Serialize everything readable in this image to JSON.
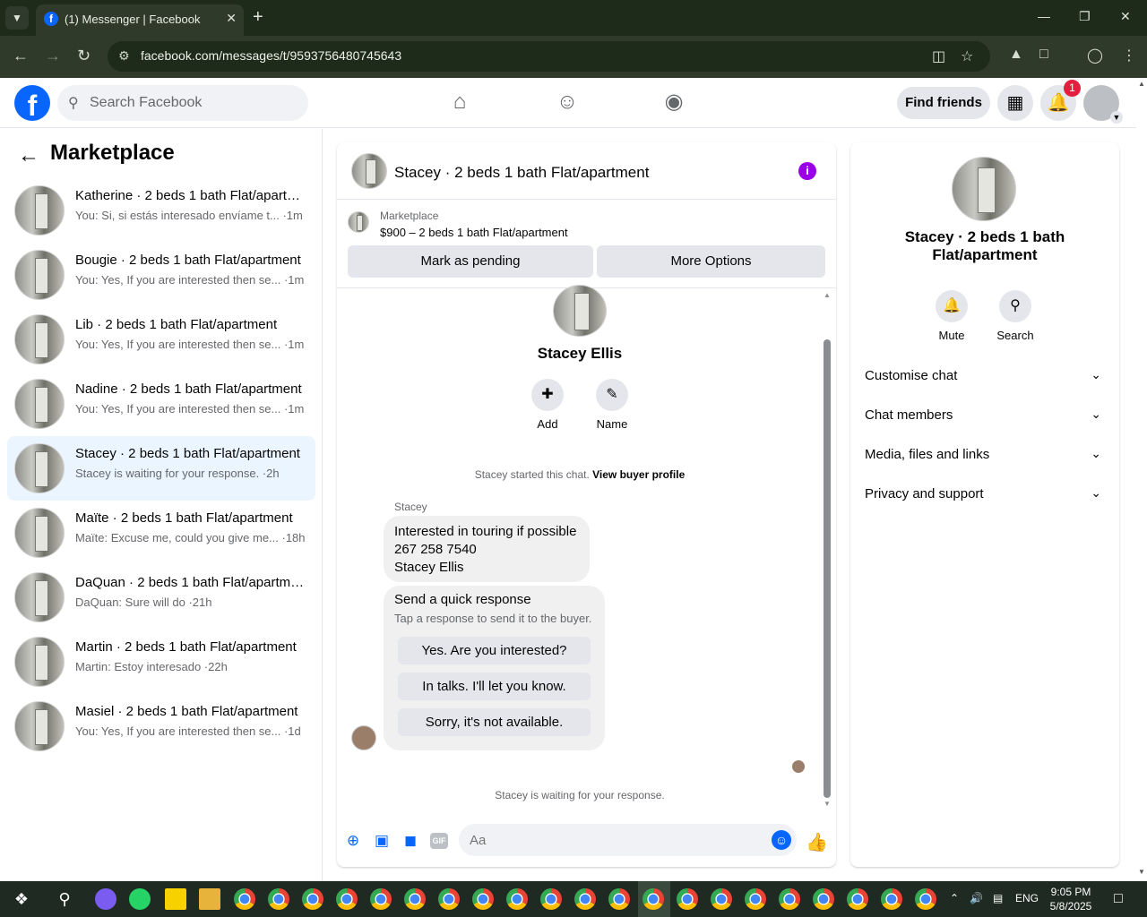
{
  "browser": {
    "tab_title": "(1) Messenger | Facebook",
    "url": "facebook.com/messages/t/9593756480745643"
  },
  "header": {
    "search_placeholder": "Search Facebook",
    "find_friends": "Find friends",
    "notification_count": "1"
  },
  "sidebar": {
    "title": "Marketplace",
    "conversations": [
      {
        "name": "Katherine · 2 beds 1 bath Flat/apartment",
        "preview": "You: Si, si estás interesado envíame t... ·1m",
        "active": false
      },
      {
        "name": "Bougie · 2 beds 1 bath Flat/apartment",
        "preview": "You: Yes, If you are interested then se... ·1m",
        "active": false
      },
      {
        "name": "Lib · 2 beds 1 bath Flat/apartment",
        "preview": "You: Yes, If you are interested then se... ·1m",
        "active": false
      },
      {
        "name": "Nadine · 2 beds 1 bath Flat/apartment",
        "preview": "You: Yes, If you are interested then se... ·1m",
        "active": false
      },
      {
        "name": "Stacey · 2 beds 1 bath Flat/apartment",
        "preview": "Stacey is waiting for your response. ·2h",
        "active": true
      },
      {
        "name": "Maïte · 2 beds 1 bath Flat/apartment",
        "preview": "Maïte: Excuse me, could you give me... ·18h",
        "active": false
      },
      {
        "name": "DaQuan · 2 beds 1 bath Flat/apartment",
        "preview": "DaQuan: Sure will do ·21h",
        "active": false
      },
      {
        "name": "Martin · 2 beds 1 bath Flat/apartment",
        "preview": "Martin: Estoy interesado ·22h",
        "active": false
      },
      {
        "name": "Masiel · 2 beds 1 bath Flat/apartment",
        "preview": "You: Yes, If you are interested then se... ·1d",
        "active": false
      }
    ]
  },
  "chat": {
    "title": "Stacey · 2 beds 1 bath Flat/apartment",
    "marketplace_label": "Marketplace",
    "listing": "$900 – 2 beds 1 bath Flat/apartment",
    "mark_pending": "Mark as pending",
    "more_options": "More Options",
    "contact_name": "Stacey Ellis",
    "add_label": "Add",
    "name_label": "Name",
    "started_text": "Stacey started this chat. ",
    "view_profile": "View buyer profile",
    "sender": "Stacey",
    "message_lines": [
      "Interested in touring if possible",
      "267 258 7540",
      "Stacey Ellis"
    ],
    "quick_title": "Send a quick response",
    "quick_sub": "Tap a response to send it to the buyer.",
    "quick_options": [
      "Yes. Are you interested?",
      "In talks. I'll let you know.",
      "Sorry, it's not available."
    ],
    "waiting": "Stacey is waiting for your response.",
    "composer_placeholder": "Aa"
  },
  "details": {
    "name": "Stacey · 2 beds 1 bath Flat/apartment",
    "mute": "Mute",
    "search": "Search",
    "sections": [
      "Customise chat",
      "Chat members",
      "Media, files and links",
      "Privacy and support"
    ]
  },
  "taskbar": {
    "lang": "ENG",
    "time": "9:05 PM",
    "date": "5/8/2025"
  },
  "colors": {
    "fb_blue": "#0866ff",
    "active_conv": "#ebf5ff",
    "info_purple": "#9900e8",
    "badge_red": "#e41e3f"
  }
}
